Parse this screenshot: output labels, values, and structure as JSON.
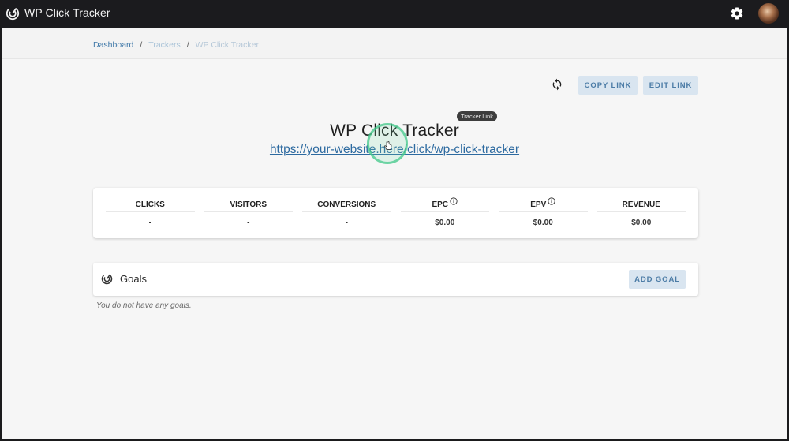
{
  "app": {
    "title": "WP Click Tracker",
    "logo_icon": "target-logo-icon",
    "settings_icon": "gear-icon",
    "avatar": "user-avatar"
  },
  "breadcrumb": {
    "items": [
      {
        "label": "Dashboard"
      },
      {
        "label": "Trackers"
      },
      {
        "label": "WP Click Tracker"
      }
    ],
    "separator": "/"
  },
  "toolbar": {
    "refresh_icon": "refresh-icon",
    "copy_link_label": "COPY LINK",
    "edit_link_label": "EDIT LINK"
  },
  "tracker": {
    "title": "WP Click Tracker",
    "url": "https://your-website.here/click/wp-click-tracker",
    "tooltip": "Tracker Link"
  },
  "stats": [
    {
      "label": "CLICKS",
      "value": "-",
      "info": false
    },
    {
      "label": "VISITORS",
      "value": "-",
      "info": false
    },
    {
      "label": "CONVERSIONS",
      "value": "-",
      "info": false
    },
    {
      "label": "EPC",
      "value": "$0.00",
      "info": true
    },
    {
      "label": "EPV",
      "value": "$0.00",
      "info": true
    },
    {
      "label": "REVENUE",
      "value": "$0.00",
      "info": false
    }
  ],
  "goals": {
    "title": "Goals",
    "add_label": "ADD GOAL",
    "empty_message": "You do not have any goals."
  }
}
